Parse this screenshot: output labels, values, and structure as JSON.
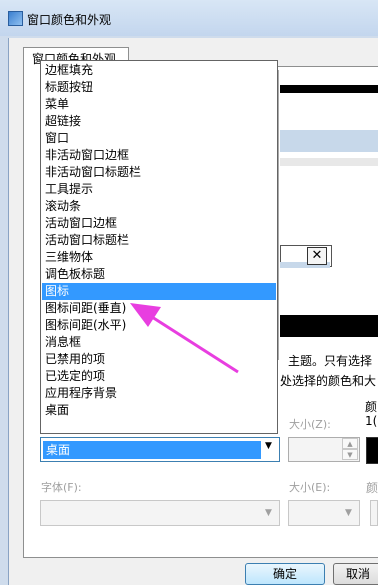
{
  "window": {
    "title": "窗口颜色和外观"
  },
  "tab": {
    "label": "窗口颜色和外观"
  },
  "preview": {
    "close_glyph": "✕"
  },
  "description": {
    "line1": "主题。只有选择",
    "line2": "处选择的颜色和大"
  },
  "item_list": {
    "items": [
      "边框填充",
      "标题按钮",
      "菜单",
      "超链接",
      "窗口",
      "非活动窗口边框",
      "非活动窗口标题栏",
      "工具提示",
      "滚动条",
      "活动窗口边框",
      "活动窗口标题栏",
      "三维物体",
      "调色板标题",
      "图标",
      "图标间距(垂直)",
      "图标间距(水平)",
      "消息框",
      "已禁用的项",
      "已选定的项",
      "应用程序背景",
      "桌面"
    ],
    "selected": "图标"
  },
  "item_combo": {
    "value": "桌面",
    "arrow": "▼"
  },
  "size1": {
    "label": "大小(Z):",
    "value": "1("
  },
  "color1": {
    "label": "颜"
  },
  "font": {
    "label": "字体(F):",
    "arrow": "▼"
  },
  "size2": {
    "label": "大小(E):",
    "arrow": "▼"
  },
  "color2": {
    "label": "颜"
  },
  "buttons": {
    "ok": "确定",
    "cancel": "取消"
  },
  "colors": {
    "selection": "#3399ff",
    "annotation_arrow": "#e83ee0"
  }
}
